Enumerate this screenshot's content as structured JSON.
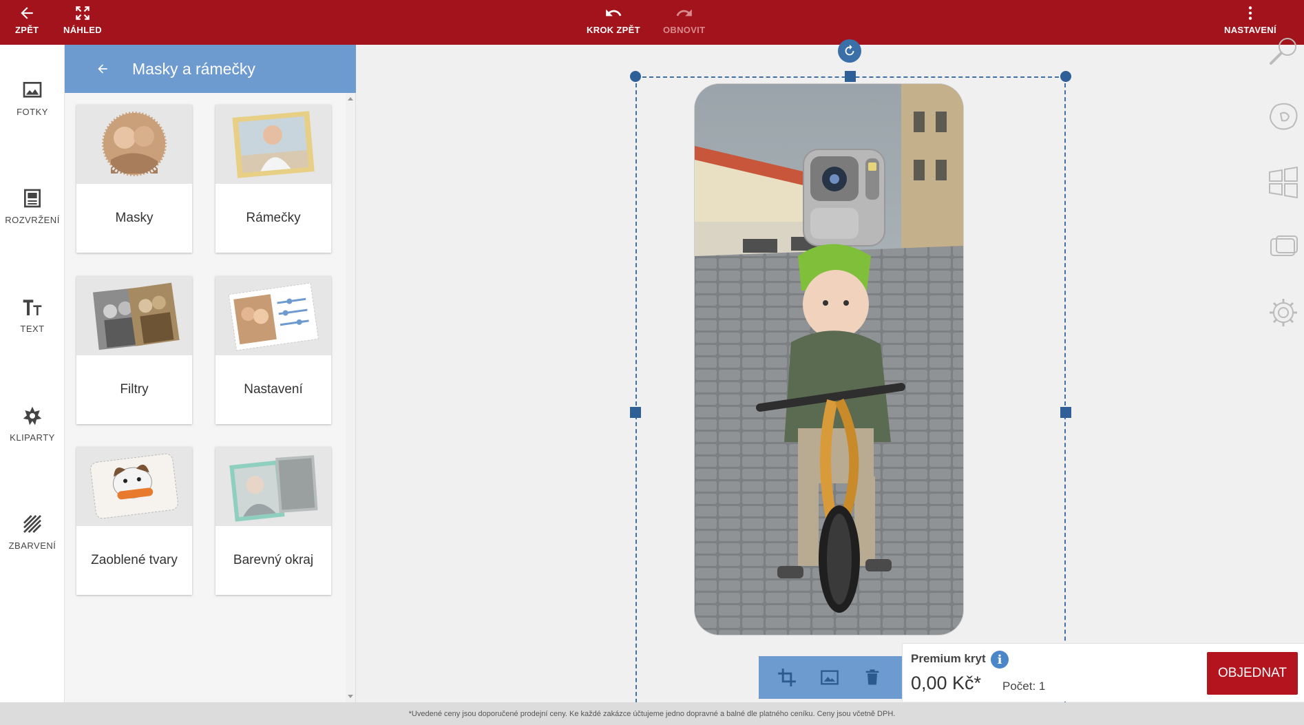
{
  "topbar": {
    "back_label": "ZPĚT",
    "preview_label": "NÁHLED",
    "undo_label": "KROK ZPĚT",
    "redo_label": "OBNOVIT",
    "settings_label": "NASTAVENÍ",
    "color": "#a3131c"
  },
  "rail": {
    "items": [
      {
        "label": "FOTKY",
        "icon": "photo-icon"
      },
      {
        "label": "ROZVRŽENÍ",
        "icon": "layout-icon"
      },
      {
        "label": "TEXT",
        "icon": "text-icon"
      },
      {
        "label": "KLIPARTY",
        "icon": "clipart-icon"
      },
      {
        "label": "ZBARVENÍ",
        "icon": "coloring-icon"
      }
    ]
  },
  "panel": {
    "title": "Masky a rámečky",
    "cards": [
      {
        "label": "Masky"
      },
      {
        "label": "Rámečky"
      },
      {
        "label": "Filtry"
      },
      {
        "label": "Nastavení"
      },
      {
        "label": "Zaoblené tvary"
      },
      {
        "label": "Barevný okraj"
      }
    ]
  },
  "order": {
    "product_name": "Premium kryt",
    "price": "0,00 Kč*",
    "quantity": "Počet: 1",
    "order_label": "OBJEDNAT"
  },
  "footer": {
    "note": "*Uvedené ceny jsou doporučené prodejní ceny. Ke každé zakázce účtujeme jedno dopravné a balné dle platného ceníku. Ceny jsou včetně DPH."
  },
  "colors": {
    "accent_blue": "#6d9bcf",
    "selection_blue": "#2f5f97",
    "order_red": "#b3141e"
  }
}
